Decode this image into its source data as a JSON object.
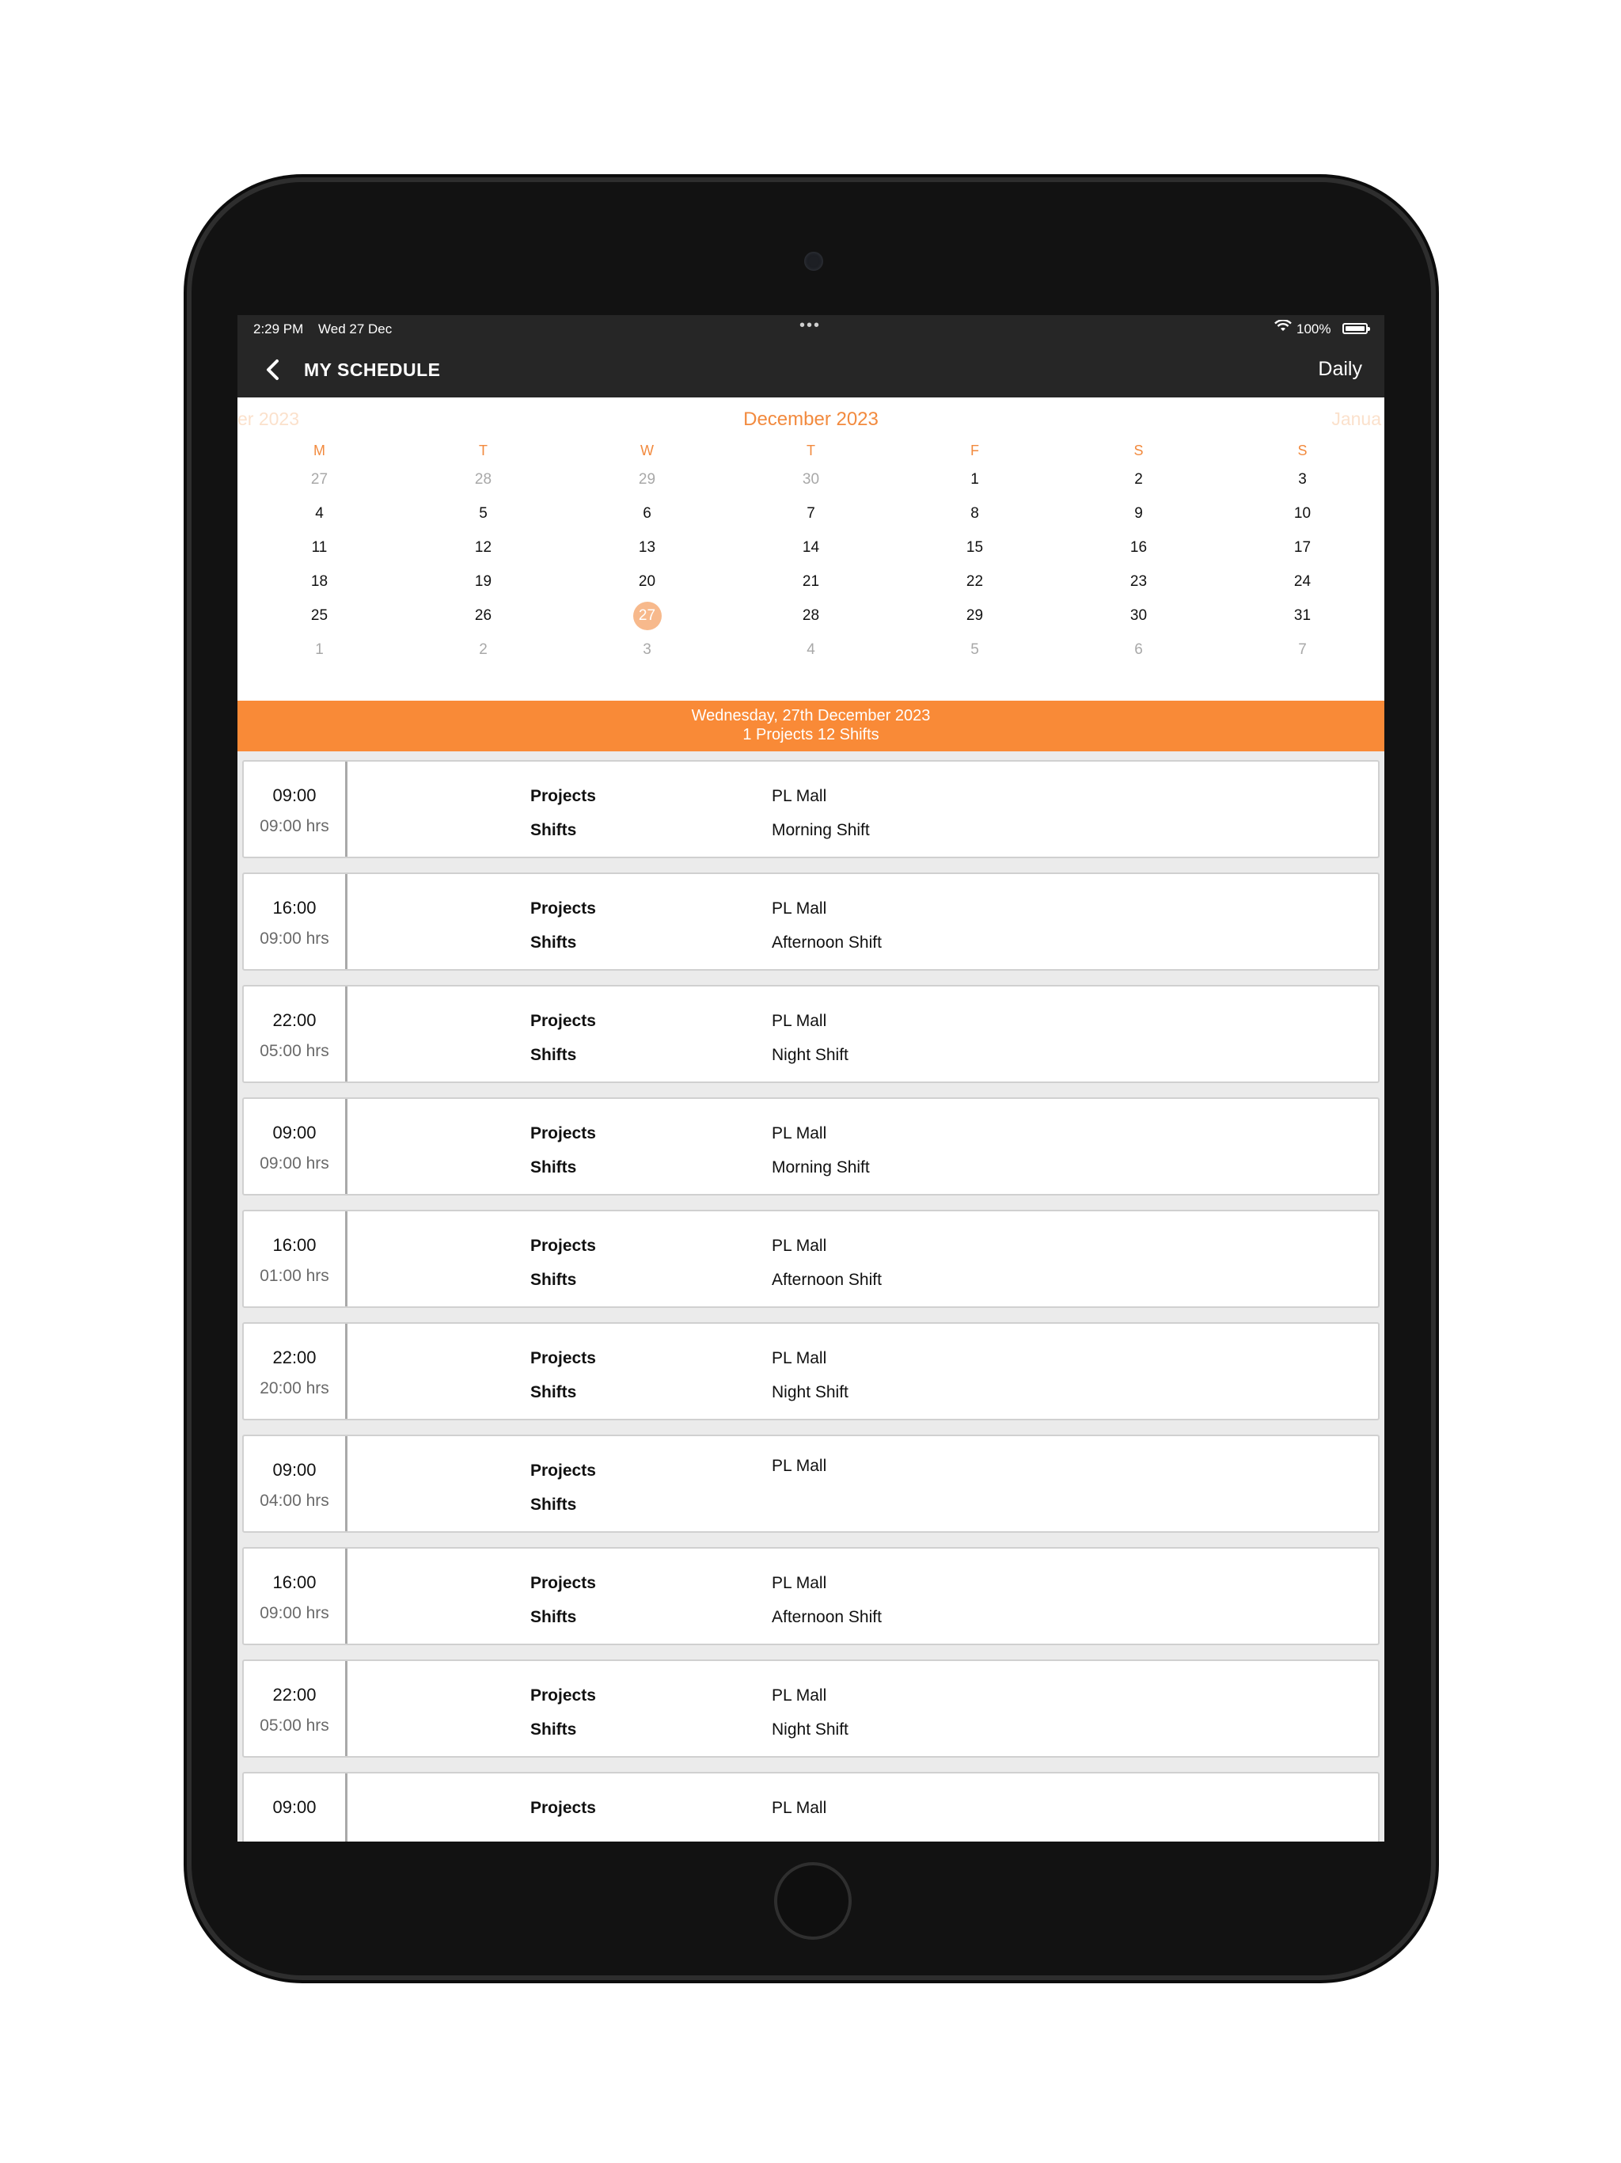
{
  "status_bar": {
    "time": "2:29 PM",
    "date": "Wed 27 Dec",
    "battery": "100%"
  },
  "nav": {
    "title": "MY SCHEDULE",
    "mode": "Daily"
  },
  "calendar": {
    "prev_month": "er 2023",
    "current_month": "December 2023",
    "next_month": "Janua",
    "weekdays": [
      "M",
      "T",
      "W",
      "T",
      "F",
      "S",
      "S"
    ],
    "weeks": [
      [
        "27",
        "28",
        "29",
        "30",
        "1",
        "2",
        "3"
      ],
      [
        "4",
        "5",
        "6",
        "7",
        "8",
        "9",
        "10"
      ],
      [
        "11",
        "12",
        "13",
        "14",
        "15",
        "16",
        "17"
      ],
      [
        "18",
        "19",
        "20",
        "21",
        "22",
        "23",
        "24"
      ],
      [
        "25",
        "26",
        "27",
        "28",
        "29",
        "30",
        "31"
      ],
      [
        "1",
        "2",
        "3",
        "4",
        "5",
        "6",
        "7"
      ]
    ],
    "selected_day": "27"
  },
  "day_banner": {
    "date_label": "Wednesday, 27th December 2023",
    "summary": "1 Projects 12 Shifts"
  },
  "list_labels": {
    "projects": "Projects",
    "shifts": "Shifts"
  },
  "shifts": [
    {
      "start": "09:00",
      "duration": "09:00 hrs",
      "project": "PL Mall",
      "shift": "Morning Shift"
    },
    {
      "start": "16:00",
      "duration": "09:00 hrs",
      "project": "PL Mall",
      "shift": "Afternoon Shift"
    },
    {
      "start": "22:00",
      "duration": "05:00 hrs",
      "project": "PL Mall",
      "shift": "Night Shift"
    },
    {
      "start": "09:00",
      "duration": "09:00 hrs",
      "project": "PL Mall",
      "shift": "Morning Shift"
    },
    {
      "start": "16:00",
      "duration": "01:00 hrs",
      "project": "PL Mall",
      "shift": "Afternoon Shift"
    },
    {
      "start": "22:00",
      "duration": "20:00 hrs",
      "project": "PL Mall",
      "shift": "Night Shift"
    },
    {
      "start": "09:00",
      "duration": "04:00 hrs",
      "project": "PL Mall",
      "shift": ""
    },
    {
      "start": "16:00",
      "duration": "09:00 hrs",
      "project": "PL Mall",
      "shift": "Afternoon Shift"
    },
    {
      "start": "22:00",
      "duration": "05:00 hrs",
      "project": "PL Mall",
      "shift": "Night Shift"
    },
    {
      "start": "09:00",
      "duration": "",
      "project": "PL Mall",
      "shift": ""
    }
  ],
  "colors": {
    "accent": "#f98a37",
    "bar": "#262626",
    "selected_day": "#f7b98c"
  }
}
